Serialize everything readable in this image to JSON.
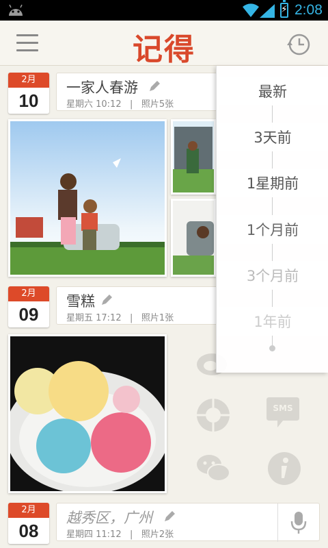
{
  "status_bar": {
    "time": "2:08"
  },
  "app": {
    "title": "记得"
  },
  "entries": [
    {
      "month": "2月",
      "day": "10",
      "title": "一家人春游",
      "weekday_time": "星期六 10:12",
      "photos": "照片5张"
    },
    {
      "month": "2月",
      "day": "09",
      "title": "雪糕",
      "weekday_time": "星期五 17:12",
      "photos": "照片1张"
    },
    {
      "month": "2月",
      "day": "08",
      "title": "越秀区，广州",
      "weekday_time": "星期四 11:12",
      "photos": "照片2张"
    }
  ],
  "separator": "|",
  "share": {
    "sms_label": "SMS"
  },
  "time_filter": {
    "options": [
      "最新",
      "3天前",
      "1星期前",
      "1个月前",
      "3个月前",
      "1年前"
    ]
  },
  "colors": {
    "accent": "#dd4a29",
    "status_text": "#35b5e5"
  },
  "icons": [
    "android-icon",
    "wifi-icon",
    "signal-icon",
    "battery-icon",
    "menu-icon",
    "history-clock-icon",
    "pencil-icon",
    "weibo-icon",
    "camera-shutter-icon",
    "sms-icon",
    "wechat-icon",
    "info-icon",
    "microphone-icon"
  ]
}
